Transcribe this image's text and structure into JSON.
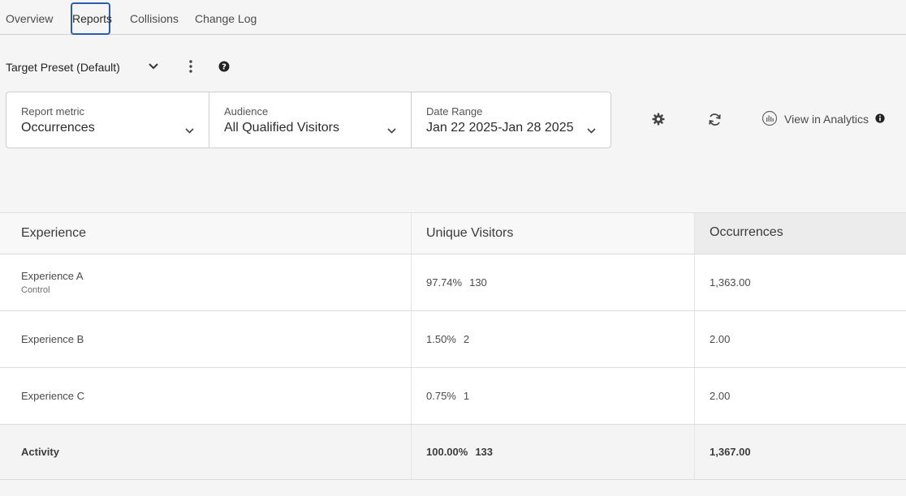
{
  "tabs": [
    {
      "label": "Overview"
    },
    {
      "label": "Reports"
    },
    {
      "label": "Collisions"
    },
    {
      "label": "Change Log"
    }
  ],
  "active_tab": "Reports",
  "preset": {
    "label": "Target Preset (Default)"
  },
  "filters": [
    {
      "label": "Report metric",
      "value": "Occurrences"
    },
    {
      "label": "Audience",
      "value": "All Qualified Visitors"
    },
    {
      "label": "Date Range",
      "value": "Jan 22 2025-Jan 28 2025"
    }
  ],
  "tools": {
    "view_in_analytics": "View in Analytics"
  },
  "icons": {
    "preset_chevron": "chevron-down-icon",
    "more": "more-vertical-icon",
    "help": "help-icon",
    "settings": "gear-icon",
    "refresh": "refresh-icon",
    "analytics": "analytics-icon",
    "info": "info-icon"
  },
  "table": {
    "columns": [
      "Experience",
      "Unique Visitors",
      "Occurrences"
    ],
    "rows": [
      {
        "name": "Experience A",
        "sub": "Control",
        "pct": "97.74%",
        "visitors": "130",
        "occurrences": "1,363.00"
      },
      {
        "name": "Experience B",
        "sub": "",
        "pct": "1.50%",
        "visitors": "2",
        "occurrences": "2.00"
      },
      {
        "name": "Experience C",
        "sub": "",
        "pct": "0.75%",
        "visitors": "1",
        "occurrences": "2.00"
      }
    ],
    "total": {
      "name": "Activity",
      "pct": "100.00%",
      "visitors": "133",
      "occurrences": "1,367.00"
    }
  },
  "colors": {
    "accent": "#2a5db0",
    "background": "#f5f5f5"
  }
}
